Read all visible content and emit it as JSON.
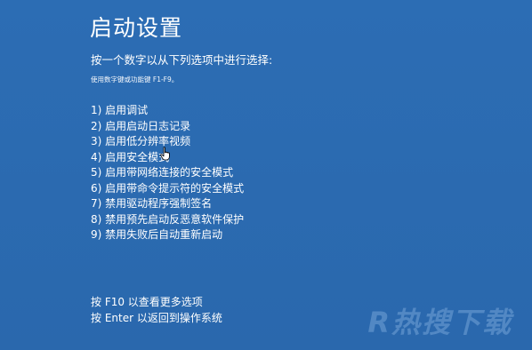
{
  "screen": {
    "title": "启动设置",
    "subtitle": "按一个数字以从下列选项中进行选择:",
    "hint": "使用数字键或功能键 F1-F9。",
    "options": [
      "1) 启用调试",
      "2) 启用启动日志记录",
      "3) 启用低分辨率视频",
      "4) 启用安全模式",
      "5) 启用带网络连接的安全模式",
      "6) 启用带命令提示符的安全模式",
      "7) 禁用驱动程序强制签名",
      "8) 禁用预先启动反恶意软件保护",
      "9) 禁用失败后自动重新启动"
    ],
    "footer": [
      "按 F10 以查看更多选项",
      "按 Enter 以返回到操作系统"
    ]
  },
  "watermark": "R热搜下载",
  "colors": {
    "background": "#2b6cb3",
    "text": "#ffffff"
  },
  "icons": {
    "cursor": "hand-pointer-icon"
  }
}
